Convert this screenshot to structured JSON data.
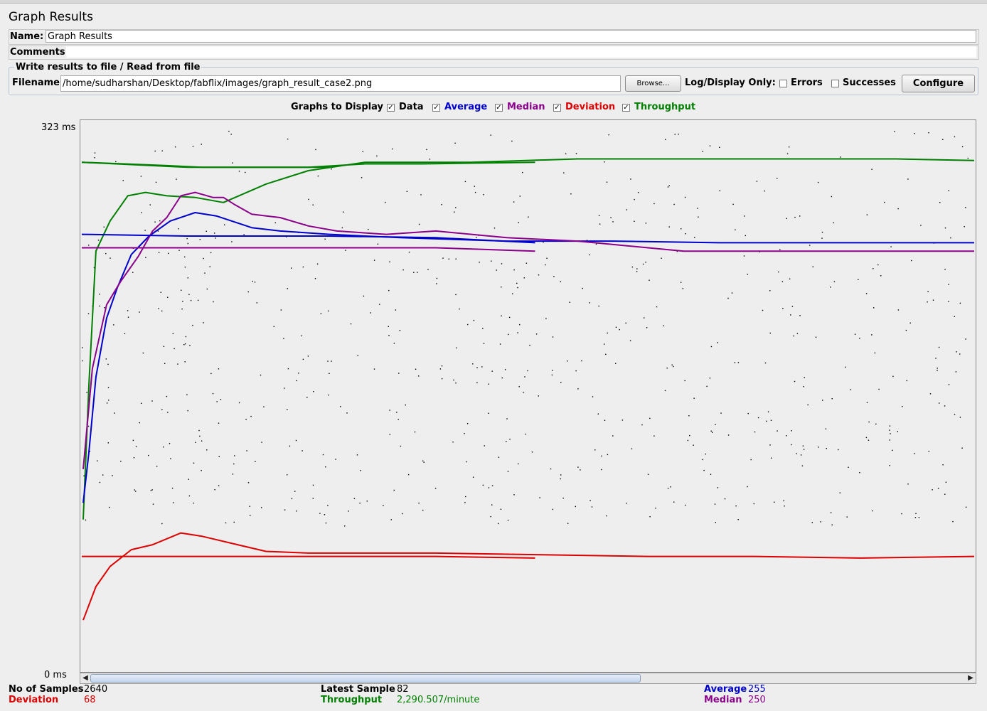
{
  "panel": {
    "title": "Graph Results",
    "name_label": "Name:",
    "name_value": "Graph Results",
    "comments_label": "Comments:",
    "comments_value": ""
  },
  "file_section": {
    "title": "Write results to file / Read from file",
    "filename_label": "Filename",
    "filename_value": "/home/sudharshan/Desktop/fabflix/images/graph_result_case2.png",
    "browse_label": "Browse...",
    "log_display_label": "Log/Display Only:",
    "errors_label": "Errors",
    "errors_checked": false,
    "successes_label": "Successes",
    "successes_checked": false,
    "configure_label": "Configure"
  },
  "graphs_to_display": {
    "label": "Graphs to Display",
    "options": [
      {
        "label": "Data",
        "checked": true,
        "color": "#000000"
      },
      {
        "label": "Average",
        "checked": true,
        "color": "#0000cc"
      },
      {
        "label": "Median",
        "checked": true,
        "color": "#8b008b"
      },
      {
        "label": "Deviation",
        "checked": true,
        "color": "#dd0000"
      },
      {
        "label": "Throughput",
        "checked": true,
        "color": "#008000"
      }
    ]
  },
  "chart_data": {
    "type": "line",
    "ylim": [
      0,
      323
    ],
    "y_top_label": "323 ms",
    "y_bottom_label": "0 ms",
    "grid": false,
    "series": [
      {
        "name": "Throughput",
        "color": "#008000",
        "points": [
          [
            0,
            303
          ],
          [
            0.6,
            302
          ],
          [
            1.2,
            301
          ],
          [
            1.7,
            300
          ],
          [
            2.3,
            300
          ],
          [
            2.7,
            300
          ],
          [
            3.5,
            300
          ]
        ]
      },
      {
        "name": "Throughput",
        "color": "#008000",
        "points": [
          [
            0.02,
            90
          ],
          [
            0.1,
            170
          ],
          [
            0.2,
            250
          ],
          [
            0.4,
            268
          ],
          [
            0.65,
            283
          ],
          [
            0.9,
            285
          ],
          [
            1.2,
            283
          ],
          [
            1.6,
            282
          ],
          [
            2.0,
            279
          ],
          [
            2.6,
            290
          ],
          [
            3.2,
            298
          ],
          [
            4.0,
            303
          ],
          [
            5.5,
            303
          ],
          [
            7.0,
            305
          ],
          [
            9.5,
            305
          ],
          [
            11.5,
            305
          ],
          [
            12.6,
            304
          ]
        ]
      },
      {
        "name": "Average",
        "color": "#0000cc",
        "points": [
          [
            0.02,
            100
          ],
          [
            0.1,
            130
          ],
          [
            0.2,
            175
          ],
          [
            0.35,
            210
          ],
          [
            0.5,
            228
          ],
          [
            0.7,
            248
          ],
          [
            0.95,
            259
          ],
          [
            1.25,
            268
          ],
          [
            1.6,
            273
          ],
          [
            1.9,
            271
          ],
          [
            2.4,
            264
          ],
          [
            2.8,
            262
          ],
          [
            3.5,
            260
          ],
          [
            4.5,
            258
          ],
          [
            6,
            256
          ],
          [
            7.5,
            256
          ],
          [
            9,
            255
          ],
          [
            10.5,
            255
          ],
          [
            12.6,
            255
          ]
        ]
      },
      {
        "name": "Median",
        "color": "#8b008b",
        "points": [
          [
            0.02,
            120
          ],
          [
            0.15,
            180
          ],
          [
            0.35,
            218
          ],
          [
            0.55,
            232
          ],
          [
            0.8,
            247
          ],
          [
            1.0,
            262
          ],
          [
            1.2,
            270
          ],
          [
            1.4,
            283
          ],
          [
            1.6,
            285
          ],
          [
            1.85,
            282
          ],
          [
            2.0,
            282
          ],
          [
            2.15,
            278
          ],
          [
            2.4,
            272
          ],
          [
            2.8,
            270
          ],
          [
            3.2,
            265
          ],
          [
            3.6,
            262
          ],
          [
            4.3,
            260
          ],
          [
            5.0,
            262
          ],
          [
            6.0,
            258
          ],
          [
            7.0,
            256
          ],
          [
            8.5,
            250
          ],
          [
            10,
            250
          ],
          [
            11,
            250
          ],
          [
            12.6,
            250
          ]
        ]
      },
      {
        "name": "Deviation",
        "color": "#dd0000",
        "points": [
          [
            0.02,
            30
          ],
          [
            0.2,
            50
          ],
          [
            0.4,
            62
          ],
          [
            0.7,
            72
          ],
          [
            1.0,
            75
          ],
          [
            1.4,
            82
          ],
          [
            1.7,
            80
          ],
          [
            2.2,
            75
          ],
          [
            2.6,
            71
          ],
          [
            3.2,
            70
          ],
          [
            4.0,
            70
          ],
          [
            5.0,
            70
          ],
          [
            6.5,
            69
          ],
          [
            8,
            68
          ],
          [
            9.5,
            68
          ],
          [
            11,
            67
          ],
          [
            12.6,
            68
          ]
        ]
      },
      {
        "name": "Throughput",
        "color": "#008000",
        "points": [
          [
            0,
            303
          ],
          [
            1.5,
            300
          ],
          [
            3.2,
            300
          ],
          [
            4.0,
            302
          ],
          [
            4.8,
            302
          ],
          [
            6.4,
            303
          ]
        ]
      },
      {
        "name": "Average",
        "color": "#0000cc",
        "points": [
          [
            0,
            260
          ],
          [
            1.5,
            259
          ],
          [
            3.5,
            259
          ],
          [
            5.0,
            258
          ],
          [
            6.4,
            255
          ]
        ]
      },
      {
        "name": "Median",
        "color": "#8b008b",
        "points": [
          [
            0,
            252
          ],
          [
            1.5,
            252
          ],
          [
            3.5,
            252
          ],
          [
            5.0,
            252
          ],
          [
            6.4,
            250
          ]
        ]
      },
      {
        "name": "Deviation",
        "color": "#dd0000",
        "points": [
          [
            0,
            68
          ],
          [
            1.5,
            68
          ],
          [
            3.5,
            68
          ],
          [
            5.0,
            68
          ],
          [
            6.4,
            67
          ]
        ]
      }
    ]
  },
  "stats": {
    "samples_label": "No of Samples",
    "samples_value": "2640",
    "deviation_label": "Deviation",
    "deviation_value": "68",
    "latest_label": "Latest Sample",
    "latest_value": "82",
    "throughput_label": "Throughput",
    "throughput_value": "2,290.507/minute",
    "average_label": "Average",
    "average_value": "255",
    "median_label": "Median",
    "median_value": "250"
  },
  "colors": {
    "average": "#0000cc",
    "median": "#8b008b",
    "deviation": "#dd0000",
    "throughput": "#008000"
  }
}
